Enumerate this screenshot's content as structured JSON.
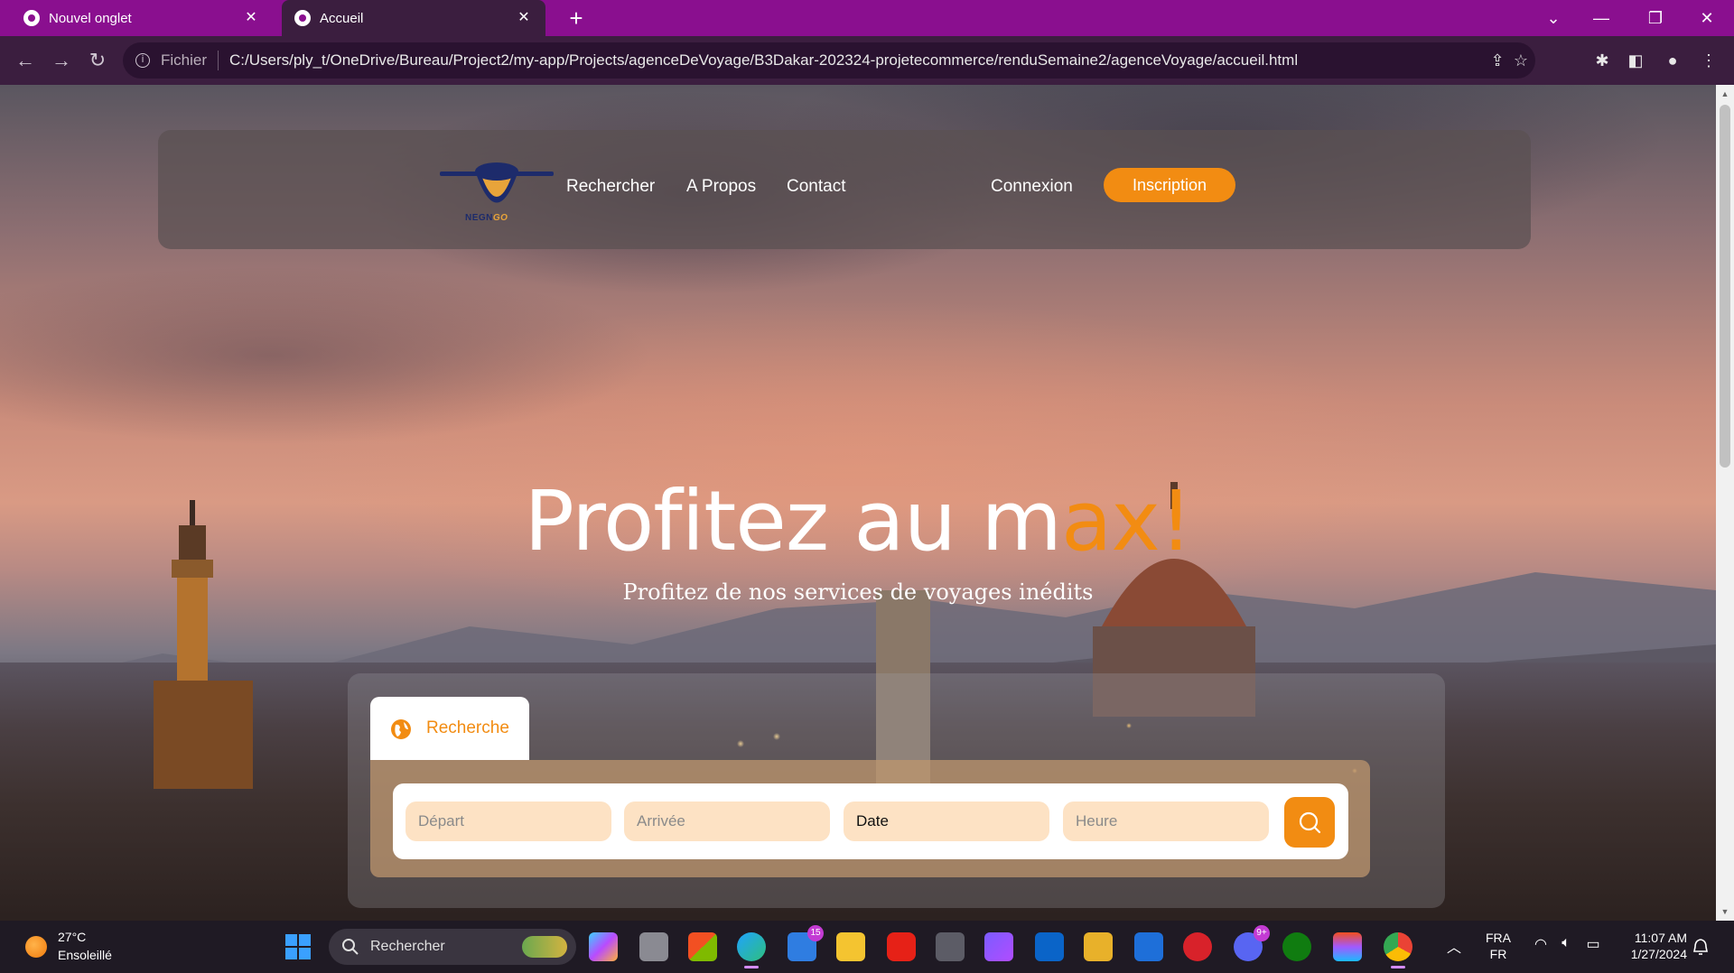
{
  "browser": {
    "tabs": [
      {
        "title": "Nouvel onglet",
        "active": false
      },
      {
        "title": "Accueil",
        "active": true
      }
    ],
    "address": {
      "scheme_label": "Fichier",
      "url": "C:/Users/ply_t/OneDrive/Bureau/Project2/my-app/Projects/agenceDeVoyage/B3Dakar-202324-projetecommerce/renduSemaine2/agenceVoyage/accueil.html"
    },
    "accent_color": "#8a0f8f"
  },
  "site": {
    "logo": {
      "text_main": "NEGN",
      "text_accent": "GO"
    },
    "nav": {
      "search": "Rechercher",
      "about": "A Propos",
      "contact": "Contact",
      "login": "Connexion",
      "signup": "Inscription"
    },
    "hero": {
      "title_main": "Profitez au m",
      "title_accent": "ax!",
      "subtitle": "Profitez de nos services de voyages inédits"
    },
    "search": {
      "tab_label": "Recherche",
      "fields": {
        "depart_placeholder": "Départ",
        "arrivee_placeholder": "Arrivée",
        "date_label": "Date",
        "heure_placeholder": "Heure"
      }
    },
    "accent_color": "#f28c12"
  },
  "taskbar": {
    "weather": {
      "temp": "27°C",
      "condition": "Ensoleillé"
    },
    "search_label": "Rechercher",
    "mail_badge": "15",
    "discord_badge": "9+",
    "language": {
      "line1": "FRA",
      "line2": "FR"
    },
    "clock": {
      "time": "11:07 AM",
      "date": "1/27/2024"
    }
  }
}
